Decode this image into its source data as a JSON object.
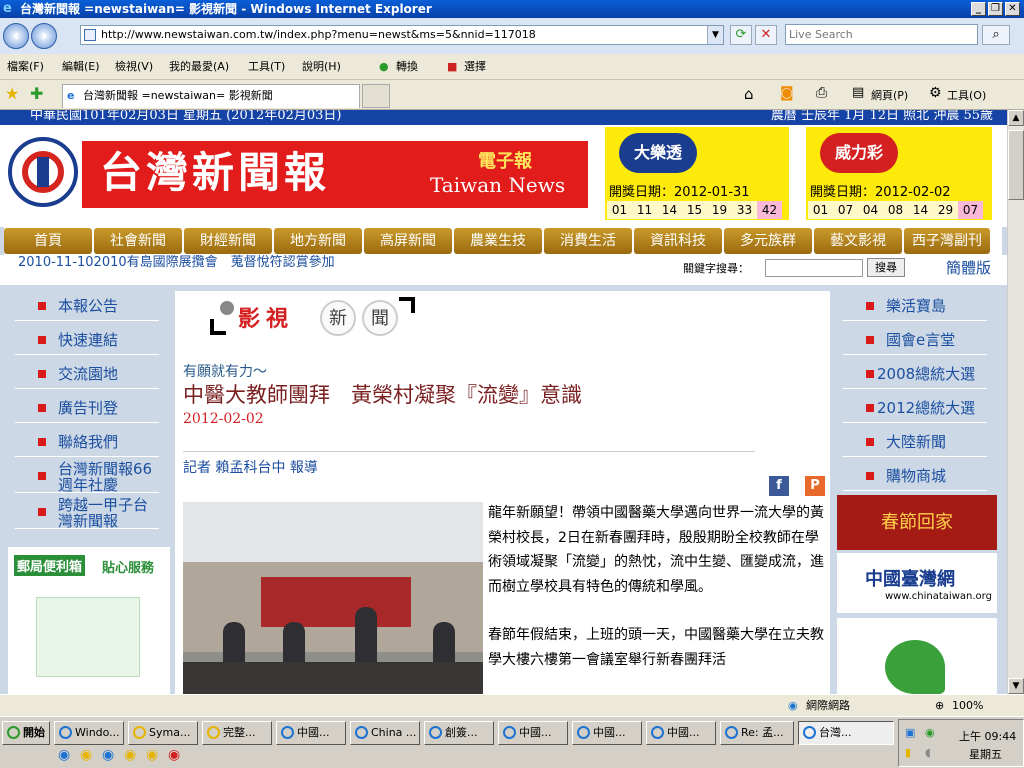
{
  "window": {
    "title": "台灣新聞報 =newstaiwan= 影視新聞 - Windows Internet Explorer",
    "min": "_",
    "max": "❐",
    "close": "✕"
  },
  "address": {
    "url": "http://www.newstaiwan.com.tw/index.php?menu=newst&ms=5&nnid=117018",
    "search_placeholder": "Live Search"
  },
  "menu": [
    "檔案(F)",
    "編輯(E)",
    "檢視(V)",
    "我的最愛(A)",
    "工具(T)",
    "說明(H)"
  ],
  "translate": {
    "convert": "轉換",
    "select": "選擇"
  },
  "tab_title": "台灣新聞報 =newstaiwan= 影視新聞",
  "cmdbar": {
    "page": "網頁(P)",
    "tools": "工具(O)"
  },
  "datebar": {
    "left": "中華民國101年02月03日 星期五 (2012年02月03日)",
    "right": "農曆 壬辰年 1月 12日 照北 沖晨 55歲"
  },
  "banner": {
    "title": "台灣新聞報",
    "sub": "電子報",
    "en": "Taiwan News"
  },
  "lotto1": {
    "logo": "大樂透",
    "date": "開獎日期：2012-01-31",
    "nums": [
      "01",
      "11",
      "14",
      "15",
      "19",
      "33"
    ],
    "special": "42"
  },
  "lotto2": {
    "logo": "威力彩",
    "date": "開獎日期：2012-02-02",
    "nums": [
      "01",
      "07",
      "04",
      "08",
      "14",
      "29"
    ],
    "special": "07"
  },
  "nav": [
    "首頁",
    "社會新聞",
    "財經新聞",
    "地方新聞",
    "高屏新聞",
    "農業生技",
    "消費生活",
    "資訊科技",
    "多元族群",
    "藝文影視",
    "西子灣副刊"
  ],
  "subbar": {
    "marquee": "2010-11-102010有島國際展攬會　蒐督悅符認賞參加",
    "kw_label": "關鍵字搜尋：",
    "kw_button": "搜尋",
    "trad": "簡體版"
  },
  "leftnav": [
    "本報公告",
    "快速連結",
    "交流園地",
    "廣告刊登",
    "聯絡我們",
    "台灣新聞報66週年社慶",
    "跨越一甲子台灣新聞報"
  ],
  "rightnav": [
    "樂活寶島",
    "國會e言堂",
    "2008總統大選",
    "2012總統大選",
    "大陸新聞",
    "購物商城"
  ],
  "stamp": {
    "t1": "影",
    "t2": "視",
    "t3": "新",
    "t4": "聞"
  },
  "article": {
    "kicker": "有願就有力～",
    "headline": "中醫大教師團拜　黃榮村凝聚『流變』意識",
    "date": "2012-02-02",
    "reporter": "記者 賴孟科台中 報導",
    "p1": "龍年新願望！帶領中國醫藥大學邁向世界一流大學的黃榮村校長，2日在新春團拜時，殷殷期盼全校教師在學術領域凝聚「流變」的熱忱，流中生變、匯變成流，進而樹立學校具有特色的傳統和學風。",
    "p2": "春節年假結束，上班的頭一天，中國醫藥大學在立夫教學大樓六樓第一會議室舉行新春團拜活"
  },
  "ads": {
    "post_h": "郵局便利箱",
    "post_h2": "貼心服務",
    "chinataiwan": "中國臺灣網",
    "chinataiwan_url": "www.chinataiwan.org",
    "ad1": "春節回家"
  },
  "status": {
    "zone": "網際網路",
    "zoom": "100%"
  },
  "taskbar": {
    "start": "開始",
    "items": [
      "Windo...",
      "Syma...",
      "完整...",
      "中國...",
      "China ...",
      "創簽...",
      "中國...",
      "中國...",
      "中國...",
      "Re: 孟...",
      "台灣..."
    ],
    "time": "上午 09:44",
    "day": "星期五"
  }
}
